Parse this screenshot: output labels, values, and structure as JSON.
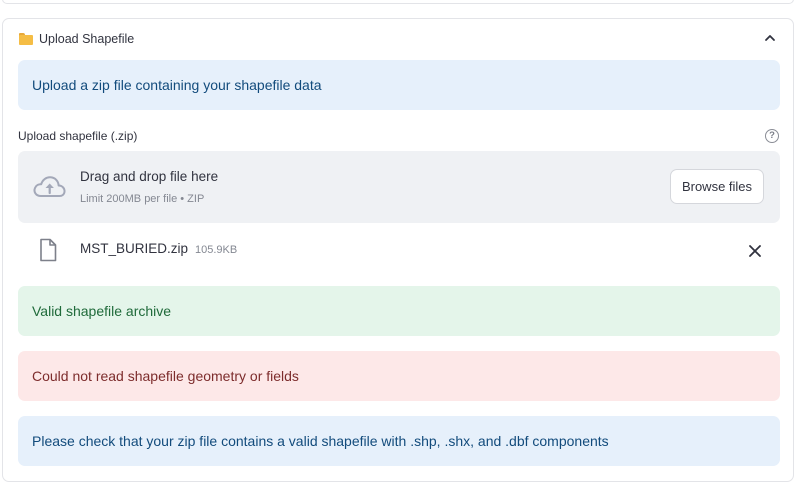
{
  "expander": {
    "title": "Upload Shapefile",
    "icon": "folder-icon",
    "toggle_icon": "chevron-up-icon"
  },
  "info_alert": {
    "text": "Upload a zip file containing your shapefile data"
  },
  "uploader": {
    "label": "Upload shapefile (.zip)",
    "help_icon": "?",
    "dropzone_title": "Drag and drop file here",
    "dropzone_limit": "Limit 200MB per file • ZIP",
    "browse_label": "Browse files"
  },
  "uploaded_file": {
    "name": "MST_BURIED.zip",
    "size": "105.9KB",
    "icon": "file-icon",
    "remove_icon": "close-icon"
  },
  "success_alert": {
    "text": "Valid shapefile archive"
  },
  "error_alert": {
    "text": "Could not read shapefile geometry or fields"
  },
  "hint_alert": {
    "text": "Please check that your zip file contains a valid shapefile with .shp, .shx, and .dbf components"
  },
  "colors": {
    "info_bg": "#e6f0fb",
    "success_bg": "#e4f5ea",
    "error_bg": "#fde8e8",
    "dropzone_bg": "#eff1f4",
    "folder": "#f5bd45"
  }
}
